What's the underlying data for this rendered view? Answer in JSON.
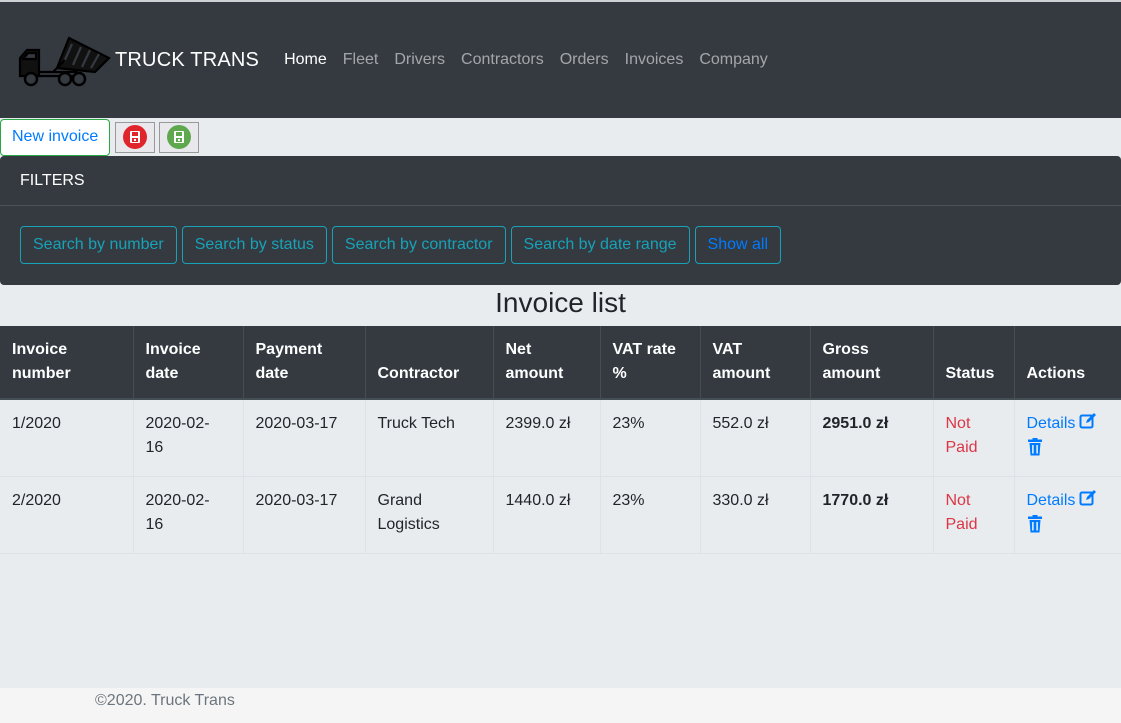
{
  "navbar": {
    "brand": "TRUCK TRANS",
    "logo_icon": "dump-truck-icon",
    "items": [
      {
        "label": "Home",
        "active": true
      },
      {
        "label": "Fleet",
        "active": false
      },
      {
        "label": "Drivers",
        "active": false
      },
      {
        "label": "Contractors",
        "active": false
      },
      {
        "label": "Orders",
        "active": false
      },
      {
        "label": "Invoices",
        "active": false
      },
      {
        "label": "Company",
        "active": false
      }
    ]
  },
  "toolbar": {
    "new_invoice_label": "New invoice",
    "icon_buttons": [
      "pdf-save-icon",
      "excel-save-icon"
    ]
  },
  "filters": {
    "header": "FILTERS",
    "buttons": [
      "Search by number",
      "Search by status",
      "Search by contractor",
      "Search by date range",
      "Show all"
    ]
  },
  "list_title": "Invoice list",
  "table": {
    "headers": [
      [
        "Invoice",
        "number"
      ],
      [
        "Invoice",
        "date"
      ],
      [
        "Payment",
        "date"
      ],
      [
        "Contractor"
      ],
      [
        "Net",
        "amount"
      ],
      [
        "VAT rate",
        "%"
      ],
      [
        "VAT",
        "amount"
      ],
      [
        "Gross",
        "amount"
      ],
      [
        "Status"
      ],
      [
        "Actions"
      ]
    ],
    "rows": [
      {
        "number": "1/2020",
        "invoice_date": [
          "2020-02-",
          "16"
        ],
        "payment_date": "2020-03-17",
        "contractor": [
          "Truck Tech"
        ],
        "net": "2399.0 zł",
        "vat_rate": "23%",
        "vat_amount": "552.0 zł",
        "gross": "2951.0 zł",
        "status": [
          "Not",
          "Paid"
        ],
        "details_label": "Details"
      },
      {
        "number": "2/2020",
        "invoice_date": [
          "2020-02-",
          "16"
        ],
        "payment_date": "2020-03-17",
        "contractor": [
          "Grand",
          "Logistics"
        ],
        "net": "1440.0 zł",
        "vat_rate": "23%",
        "vat_amount": "330.0 zł",
        "gross": "1770.0 zł",
        "status": [
          "Not",
          "Paid"
        ],
        "details_label": "Details"
      }
    ]
  },
  "footer": "©2020. Truck Trans",
  "colors": {
    "navbar_bg": "#343a40",
    "link": "#007bff",
    "info": "#17a2b8",
    "danger": "#dc3545",
    "success": "#28a745"
  }
}
